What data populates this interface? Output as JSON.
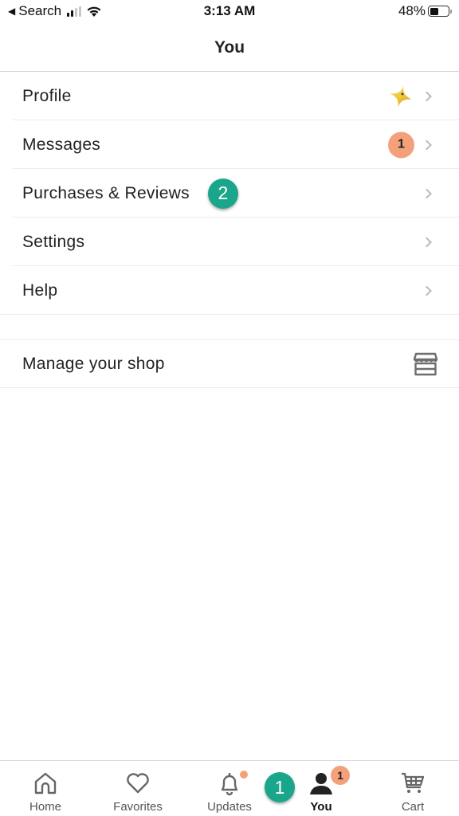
{
  "status_bar": {
    "back_label": "Search",
    "time": "3:13 AM",
    "battery_percent_label": "48%",
    "battery_level": 0.48,
    "signal_bars_active": 2,
    "signal_bars_total": 4
  },
  "header": {
    "title": "You"
  },
  "menu": {
    "items": [
      {
        "label": "Profile",
        "accessory": "star-icon"
      },
      {
        "label": "Messages",
        "badge": "1"
      },
      {
        "label": "Purchases & Reviews",
        "step_marker": "2"
      },
      {
        "label": "Settings"
      },
      {
        "label": "Help"
      }
    ],
    "shop": {
      "label": "Manage your shop",
      "icon": "storefront-icon"
    }
  },
  "tab_bar": {
    "tabs": [
      {
        "label": "Home",
        "icon": "home-icon"
      },
      {
        "label": "Favorites",
        "icon": "heart-icon"
      },
      {
        "label": "Updates",
        "icon": "bell-icon",
        "has_dot": true
      },
      {
        "label": "You",
        "icon": "person-icon",
        "badge": "1",
        "active": true
      },
      {
        "label": "Cart",
        "icon": "cart-icon"
      }
    ],
    "step_marker": "1"
  },
  "colors": {
    "accent_green": "#1aa68a",
    "badge_orange": "#f4a07a",
    "text": "#222222",
    "chevron": "#b9b9b9",
    "divider": "#ececec",
    "star_gold": "#f0c63a"
  }
}
